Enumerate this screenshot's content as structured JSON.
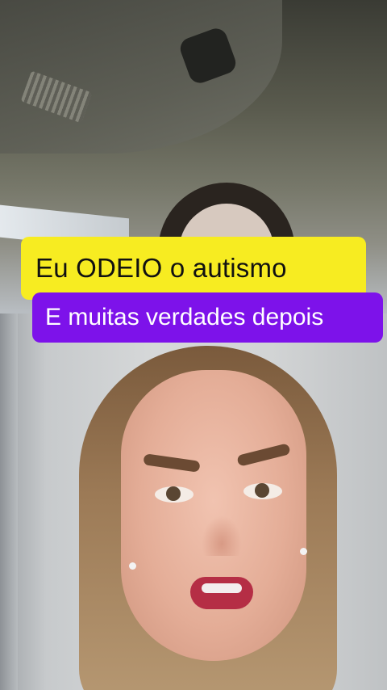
{
  "captions": {
    "top_caption": "Eu ODEIO o autismo",
    "bottom_caption": "E muitas verdades depois"
  },
  "colors": {
    "top_caption_bg": "#f7ec21",
    "bottom_caption_bg": "#7d12ea"
  }
}
